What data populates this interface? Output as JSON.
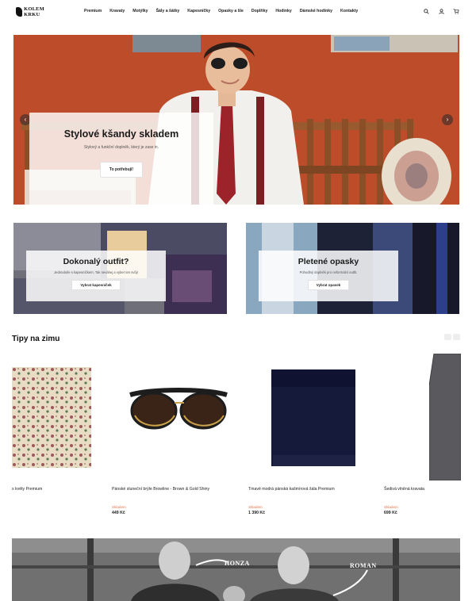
{
  "brand": {
    "logo_line1": "KOLEM",
    "logo_line2": "KRKU"
  },
  "nav": [
    "Premium",
    "Kravaty",
    "Motýlky",
    "Šály a šátky",
    "Kapesníčky",
    "Opasky a šle",
    "Doplňky",
    "Hodinky",
    "Dámské hodinky",
    "Kontakty"
  ],
  "header_icons": [
    "search-icon",
    "user-icon",
    "cart-icon"
  ],
  "hero": {
    "title": "Stylové kšandy skladem",
    "subtitle": "Stylový a funkční doplněk, který je zase in.",
    "button": "To potřebuji!",
    "prev_arrow": "‹",
    "next_arrow": "›"
  },
  "promos": [
    {
      "title": "Dokonalý outfit?",
      "subtitle": "Jednoduše s kapesníčkem. Tak neváhej a vyber ten svůj!",
      "button": "Vybrat kapesníček"
    },
    {
      "title": "Pletené opasky",
      "subtitle": "Pohodlný doplněk pro neformální outfit.",
      "button": "Vybrat opasek"
    }
  ],
  "section": {
    "title": "Tipy na zimu"
  },
  "products": [
    {
      "name": "s květy Premium",
      "stock": "",
      "price": ""
    },
    {
      "name": "Pánské sluneční brýle Browline - Brown & Gold Shiny",
      "stock": "Skladem",
      "price": "449 Kč"
    },
    {
      "name": "Tmavě modrá pánská kašmírová šála Premium",
      "stock": "Skladem",
      "price": "1 390 Kč"
    },
    {
      "name": "Šedivá vlněná kravata",
      "stock": "Skladem",
      "price": "699 Kč"
    }
  ],
  "team": {
    "label1": "HONZA",
    "label2": "ROMAN"
  },
  "colors": {
    "accent_stock": "#e0784f",
    "hero_wall": "#c4502a"
  }
}
